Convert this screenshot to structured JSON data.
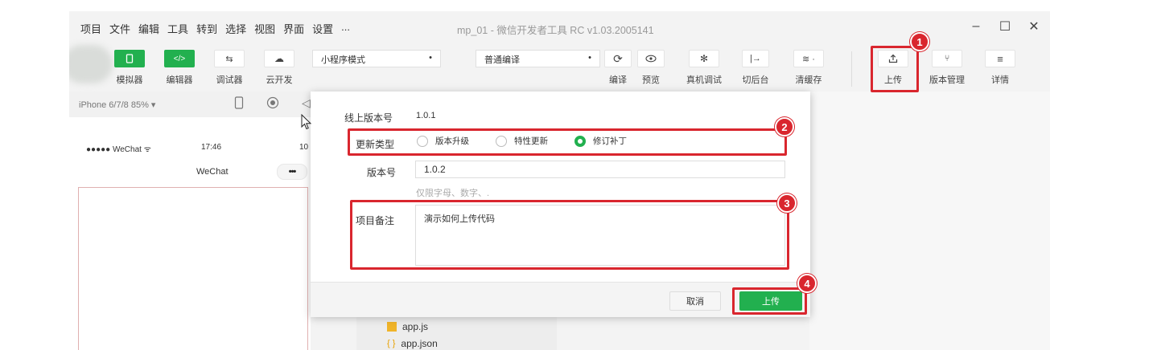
{
  "menu": [
    "项目",
    "文件",
    "编辑",
    "工具",
    "转到",
    "选择",
    "视图",
    "界面",
    "设置",
    "..."
  ],
  "window_title": "mp_01 - 微信开发者工具 RC v1.03.2005141",
  "window_controls": {
    "minimize": "–",
    "maximize": "☐",
    "close": "✕"
  },
  "toolbar": {
    "simulator": "模拟器",
    "editor": "编辑器",
    "debugger": "调试器",
    "cloud": "云开发",
    "mode_select": "小程序模式",
    "compile_select": "普通编译",
    "compile": "编译",
    "preview": "预览",
    "device_debug": "真机调试",
    "background": "切后台",
    "clear_cache": "清缓存",
    "upload": "上传",
    "version_mgmt": "版本管理",
    "details": "详情"
  },
  "simulator": {
    "device": "iPhone 6/7/8 85% ▾",
    "carrier": "●●●●● WeChat",
    "time": "17:46",
    "battery": "10",
    "nav_title": "WeChat",
    "capsule": "•••"
  },
  "files": [
    "app.js",
    "app.json"
  ],
  "dialog": {
    "online_version_label": "线上版本号",
    "online_version": "1.0.1",
    "update_type_label": "更新类型",
    "update_options": [
      "版本升级",
      "特性更新",
      "修订补丁"
    ],
    "selected_option": 2,
    "version_label": "版本号",
    "version_value": "1.0.2",
    "version_hint": "仅限字母、数字、.",
    "note_label": "项目备注",
    "note_value": "演示如何上传代码",
    "cancel": "取消",
    "upload": "上传"
  },
  "markers": [
    "1",
    "2",
    "3",
    "4"
  ],
  "colors": {
    "accent_green": "#22b04f",
    "highlight_red": "#d9262e"
  }
}
